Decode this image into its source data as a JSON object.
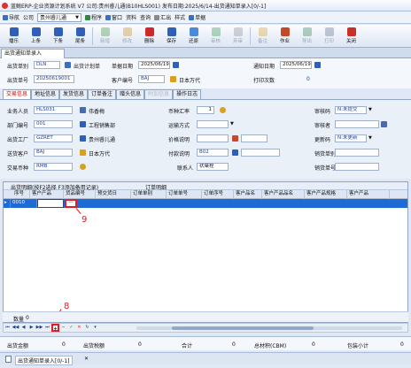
{
  "window": {
    "title": "蓝鲸ERP-企业资源计划系统 V7 公司:贵州睿儿通(B10HLS001) 发布日期:2025/6/14-出货通知单录入[0/-1]"
  },
  "menubar": {
    "items": [
      "导航",
      "公司",
      "程序",
      "窗口",
      "资料",
      "查询",
      "汇出",
      "样式",
      "单据"
    ],
    "company_value": "贵州睿儿通"
  },
  "toolbar": {
    "buttons": [
      "播乐",
      "上条",
      "下条",
      "尾条",
      "新增",
      "修改",
      "删除",
      "保存",
      "还原",
      "审核",
      "弃审",
      "备注",
      "作业",
      "导出",
      "打印",
      "关闭"
    ]
  },
  "doc_tab": {
    "label": "出货通知单录入"
  },
  "header": {
    "ship_no_label": "出货单别",
    "ship_no_value": "DLN",
    "plan_link": "出货计划单",
    "order_date_label": "单据日期",
    "order_date_value": "2025/06/19",
    "notice_date_label": "通知日期",
    "notice_date_value": "2025/06/19",
    "ship_num_label": "出货单号",
    "ship_num_value": "20250619001",
    "cust_no_label": "客户编号",
    "cust_no_value": "BAJ",
    "cust_name": "日本万代",
    "print_count_label": "打印次数",
    "print_count_value": "0"
  },
  "subtabs": [
    "交易信息",
    "地址信息",
    "发货信息",
    "订单备注",
    "赠头信息",
    "附加信息",
    "操作日志"
  ],
  "info": {
    "sales_label": "业务人员",
    "sales_value": "HLS031",
    "sales_name": "伟香梅",
    "currency_rate_label": "币种汇率",
    "currency_rate_value": "1",
    "audit_label": "审核码",
    "audit_value": "N:未提交",
    "dept_label": "部门编号",
    "dept_value": "001",
    "dept_name": "工程销售部",
    "transport_label": "运输方式",
    "auditor_label": "审核者",
    "factory_label": "出货工厂",
    "factory_value": "GZRET",
    "factory_name": "贵州睿儿通",
    "price_label": "价格说明",
    "change_label": "更新码",
    "change_value": "N:未更新",
    "customer_label": "送货客户",
    "customer_value": "BAJ",
    "customer_name": "日本万代",
    "payment_label": "付款说明",
    "payment_value": "B02",
    "sales_no_label": "销货单别",
    "currency_label": "交易币种",
    "currency_value": "RMB",
    "contact_label": "联系人",
    "contact_value": "状葉程",
    "sales_num_label": "销货单号"
  },
  "grid": {
    "caption": "出货明细(按F2选择 F3添加备用记录)",
    "caption2": "订单明细",
    "columns": [
      "序号",
      "客户产品",
      "货品编号",
      "预交货日",
      "订单单别",
      "订单单号",
      "订单序号",
      "客户品名",
      "客户产品品名",
      "客户产品规格",
      "客户产品"
    ],
    "row": {
      "seq": "0010"
    },
    "count_label": "数量",
    "count_value": "0"
  },
  "annotations": {
    "a8": "8",
    "a9": "9"
  },
  "footer": {
    "qty_label": "出货金额",
    "qty_value": "0",
    "tax_label": "出货税额",
    "tax_value": "0",
    "total_label": "合计",
    "total_value": "0",
    "cbm_label": "总材积(CBM)",
    "cbm_value": "0",
    "pack_label": "包装小计",
    "pack_value": "0"
  },
  "bottom_tab": {
    "label": "出货通知单录入[0/-1]"
  }
}
